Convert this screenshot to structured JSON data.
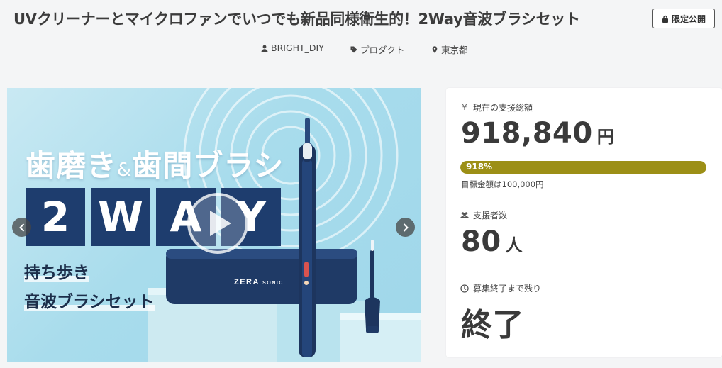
{
  "project": {
    "title": "UVクリーナーとマイクロファンでいつでも新品同様衛生的！2Way音波ブラシセット",
    "badge": "限定公開",
    "owner": "BRIGHT_DIY",
    "category": "プロダクト",
    "location": "東京都"
  },
  "hero": {
    "headline_part1": "歯磨き",
    "headline_amp": "&",
    "headline_part2": "歯間ブラシ",
    "way_letters": [
      "2",
      "W",
      "A",
      "Y"
    ],
    "sub_line1": "持ち歩き",
    "sub_line2": "音波ブラシセット",
    "case_brand": "ZERA",
    "case_brand_sub": "SONIC"
  },
  "stats": {
    "amount_label": "現在の支援総額",
    "amount_value": "918,840",
    "amount_unit": "円",
    "progress_percent": 918,
    "progress_text": "918%",
    "goal_text": "目標金額は100,000円",
    "supporters_label": "支援者数",
    "supporters_value": "80",
    "supporters_unit": "人",
    "remaining_label": "募集終了まで残り",
    "remaining_value": "終了"
  },
  "icons": {
    "currency": "yen-icon",
    "supporters": "users-icon",
    "remaining": "clock-icon",
    "badge": "lock-icon",
    "owner": "user-icon",
    "category": "tag-icon",
    "location": "map-pin-icon"
  },
  "colors": {
    "progress": "#9c8f16",
    "way_box": "#1e3d6e",
    "hero_bg": "#a8dcec"
  }
}
